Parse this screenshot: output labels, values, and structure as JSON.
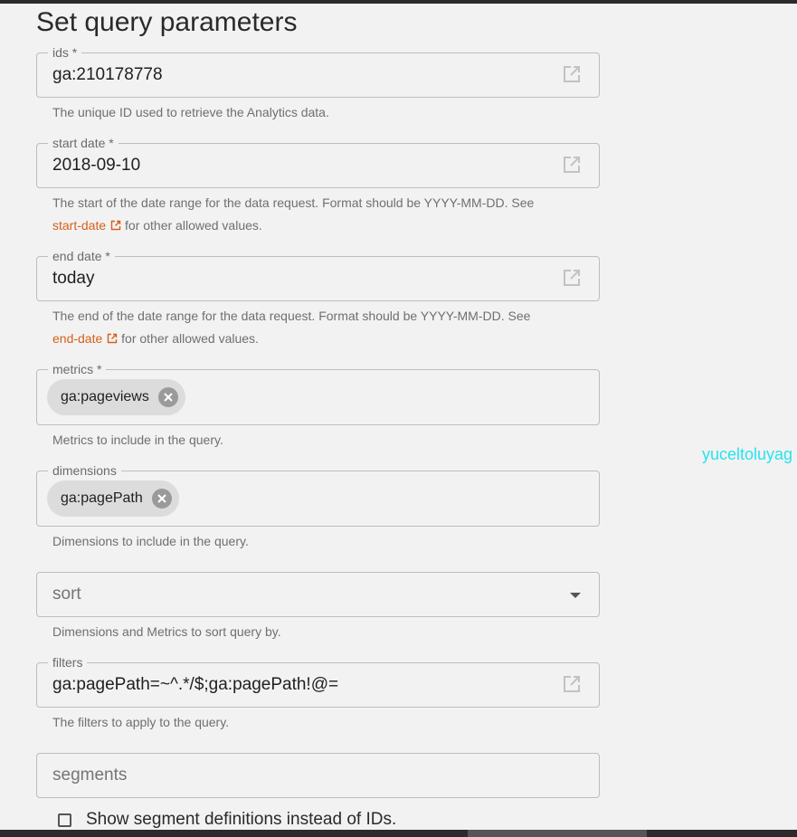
{
  "title": "Set query parameters",
  "colors": {
    "background": "#f2f2f2",
    "link": "#d5601a",
    "watermark": "#27e3f0",
    "chip": "#dcdcdc"
  },
  "fields": {
    "ids": {
      "label": "ids *",
      "value": "ga:210178778",
      "hint": "The unique ID used to retrieve the Analytics data.",
      "icon": "open-in-new-icon"
    },
    "start_date": {
      "label": "start date *",
      "value": "2018-09-10",
      "hint_text": "The start of the date range for the data request. Format should be YYYY-MM-DD. See",
      "hint_link": "start-date",
      "hint_suffix": "for other allowed values.",
      "icon": "open-in-new-icon"
    },
    "end_date": {
      "label": "end date *",
      "value": "today",
      "hint_text": "The end of the date range for the data request. Format should be YYYY-MM-DD. See",
      "hint_link": "end-date",
      "hint_suffix": "for other allowed values.",
      "icon": "open-in-new-icon"
    },
    "metrics": {
      "label": "metrics *",
      "chips": [
        "ga:pageviews"
      ],
      "hint": "Metrics to include in the query.",
      "chip_icon": "cancel-icon"
    },
    "dimensions": {
      "label": "dimensions",
      "chips": [
        "ga:pagePath"
      ],
      "hint": "Dimensions to include in the query.",
      "chip_icon": "cancel-icon"
    },
    "sort": {
      "placeholder": "sort",
      "hint": "Dimensions and Metrics to sort query by.",
      "icon": "dropdown-arrow-icon"
    },
    "filters": {
      "label": "filters",
      "value": "ga:pagePath=~^.*/$;ga:pagePath!@=",
      "hint": "The filters to apply to the query.",
      "icon": "open-in-new-icon"
    },
    "segments": {
      "placeholder": "segments"
    }
  },
  "checkbox": {
    "label": "Show segment definitions instead of IDs.",
    "checked": false
  },
  "watermark": "yuceltoluyag"
}
